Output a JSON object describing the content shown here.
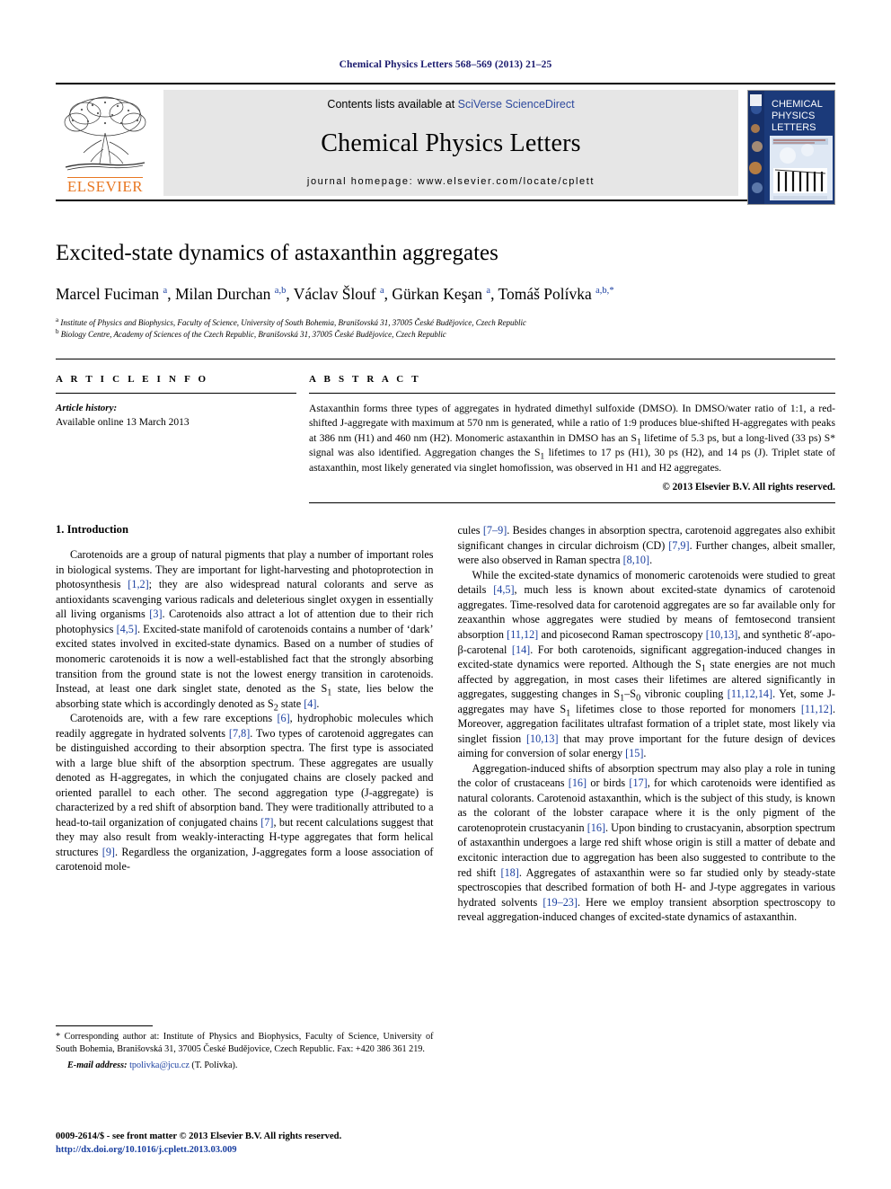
{
  "running_head": "Chemical Physics Letters 568–569 (2013) 21–25",
  "banner": {
    "publisher_name": "ELSEVIER",
    "contents_prefix": "Contents lists available at ",
    "contents_link": "SciVerse ScienceDirect",
    "journal_title": "Chemical Physics Letters",
    "homepage": "journal homepage: www.elsevier.com/locate/cplett",
    "cover": {
      "line1": "CHEMICAL",
      "line2": "PHYSICS",
      "line3": "LETTERS"
    }
  },
  "article": {
    "title": "Excited-state dynamics of astaxanthin aggregates",
    "authors": "Marcel Fuciman a, Milan Durchan a,b, Václav Šlouf a, Gürkan Keşan a, Tomáš Polívka a,b,*",
    "affiliation_a": "a Institute of Physics and Biophysics, Faculty of Science, University of South Bohemia, Branišovská 31, 37005 České Budějovice, Czech Republic",
    "affiliation_b": "b Biology Centre, Academy of Sciences of the Czech Republic, Branišovská 31, 37005 České Budějovice, Czech Republic"
  },
  "article_info": {
    "heading": "A R T I C L E    I N F O",
    "history_label": "Article history:",
    "history_value": "Available online 13 March 2013"
  },
  "abstract": {
    "heading": "A B S T R A C T",
    "text": "Astaxanthin forms three types of aggregates in hydrated dimethyl sulfoxide (DMSO). In DMSO/water ratio of 1:1, a red-shifted J-aggregate with maximum at 570 nm is generated, while a ratio of 1:9 produces blue-shifted H-aggregates with peaks at 386 nm (H1) and 460 nm (H2). Monomeric astaxanthin in DMSO has an S1 lifetime of 5.3 ps, but a long-lived (33 ps) S* signal was also identified. Aggregation changes the S1 lifetimes to 17 ps (H1), 30 ps (H2), and 14 ps (J). Triplet state of astaxanthin, most likely generated via singlet homofission, was observed in H1 and H2 aggregates.",
    "copyright": "© 2013 Elsevier B.V. All rights reserved."
  },
  "body": {
    "section_title": "1. Introduction",
    "left_paragraphs": [
      "Carotenoids are a group of natural pigments that play a number of important roles in biological systems. They are important for light-harvesting and photoprotection in photosynthesis [1,2]; they are also widespread natural colorants and serve as antioxidants scavenging various radicals and deleterious singlet oxygen in essentially all living organisms [3]. Carotenoids also attract a lot of attention due to their rich photophysics [4,5]. Excited-state manifold of carotenoids contains a number of ‘dark’ excited states involved in excited-state dynamics. Based on a number of studies of monomeric carotenoids it is now a well-established fact that the strongly absorbing transition from the ground state is not the lowest energy transition in carotenoids. Instead, at least one dark singlet state, denoted as the S1 state, lies below the absorbing state which is accordingly denoted as S2 state [4].",
      "Carotenoids are, with a few rare exceptions [6], hydrophobic molecules which readily aggregate in hydrated solvents [7,8]. Two types of carotenoid aggregates can be distinguished according to their absorption spectra. The first type is associated with a large blue shift of the absorption spectrum. These aggregates are usually denoted as H-aggregates, in which the conjugated chains are closely packed and oriented parallel to each other. The second aggregation type (J-aggregate) is characterized by a red shift of absorption band. They were traditionally attributed to a head-to-tail organization of conjugated chains [7], but recent calculations suggest that they may also result from weakly-interacting H-type aggregates that form helical structures [9]. Regardless the organization, J-aggregates form a loose association of carotenoid mole-"
    ],
    "right_paragraphs": [
      "cules [7–9]. Besides changes in absorption spectra, carotenoid aggregates also exhibit significant changes in circular dichroism (CD) [7,9]. Further changes, albeit smaller, were also observed in Raman spectra [8,10].",
      "While the excited-state dynamics of monomeric carotenoids were studied to great details [4,5], much less is known about excited-state dynamics of carotenoid aggregates. Time-resolved data for carotenoid aggregates are so far available only for zeaxanthin whose aggregates were studied by means of femtosecond transient absorption [11,12] and picosecond Raman spectroscopy [10,13], and synthetic 8′-apo-β-carotenal [14]. For both carotenoids, significant aggregation-induced changes in excited-state dynamics were reported. Although the S1 state energies are not much affected by aggregation, in most cases their lifetimes are altered significantly in aggregates, suggesting changes in S1–S0 vibronic coupling [11,12,14]. Yet, some J-aggregates may have S1 lifetimes close to those reported for monomers [11,12]. Moreover, aggregation facilitates ultrafast formation of a triplet state, most likely via singlet fission [10,13] that may prove important for the future design of devices aiming for conversion of solar energy [15].",
      "Aggregation-induced shifts of absorption spectrum may also play a role in tuning the color of crustaceans [16] or birds [17], for which carotenoids were identified as natural colorants. Carotenoid astaxanthin, which is the subject of this study, is known as the colorant of the lobster carapace where it is the only pigment of the carotenoprotein crustacyanin [16]. Upon binding to crustacyanin, absorption spectrum of astaxanthin undergoes a large red shift whose origin is still a matter of debate and excitonic interaction due to aggregation has been also suggested to contribute to the red shift [18]. Aggregates of astaxanthin were so far studied only by steady-state spectroscopies that described formation of both H- and J-type aggregates in various hydrated solvents [19–23]. Here we employ transient absorption spectroscopy to reveal aggregation-induced changes of excited-state dynamics of astaxanthin."
    ]
  },
  "footnote": {
    "corresponding": "* Corresponding author at: Institute of Physics and Biophysics, Faculty of Science, University of South Bohemia, Branišovská 31, 37005 České Budějovice, Czech Republic. Fax: +420 386 361 219.",
    "email_label": "E-mail address:",
    "email_address": "tpolivka@jcu.cz",
    "email_suffix": "(T. Polívka)."
  },
  "footer": {
    "line1": "0009-2614/$ - see front matter © 2013 Elsevier B.V. All rights reserved.",
    "line2": "http://dx.doi.org/10.1016/j.cplett.2013.03.009"
  },
  "colors": {
    "link_blue": "#1a3fa0",
    "header_navy": "#1a1a6e",
    "elsevier_orange": "#E87722",
    "banner_gray": "#e6e6e6",
    "cover_navy": "#1b3a7a"
  }
}
